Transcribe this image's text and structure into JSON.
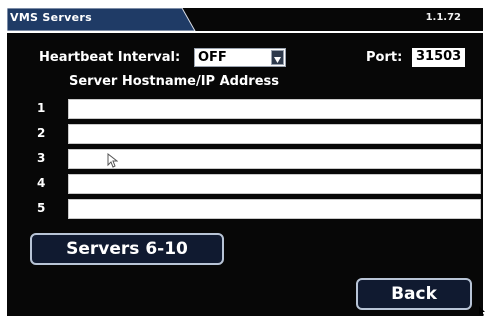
{
  "header": {
    "title": "VMS Servers",
    "version": "1.1.72"
  },
  "heartbeat": {
    "label": "Heartbeat Interval:",
    "value": "OFF"
  },
  "port": {
    "label": "Port:",
    "value": "31503"
  },
  "servers_table": {
    "column_header": "Server Hostname/IP Address",
    "rows": [
      {
        "number": "1",
        "value": ""
      },
      {
        "number": "2",
        "value": ""
      },
      {
        "number": "3",
        "value": ""
      },
      {
        "number": "4",
        "value": ""
      },
      {
        "number": "5",
        "value": ""
      }
    ]
  },
  "buttons": {
    "servers_next": "Servers 6-10",
    "back": "Back"
  },
  "icons": {
    "dropdown": "chevron-down-icon",
    "pointer": "mouse-cursor-icon"
  },
  "colors": {
    "background": "#070707",
    "button_fill": "#101a30",
    "button_border": "#b8c4d6",
    "tab_fill": "#1f3b66"
  }
}
